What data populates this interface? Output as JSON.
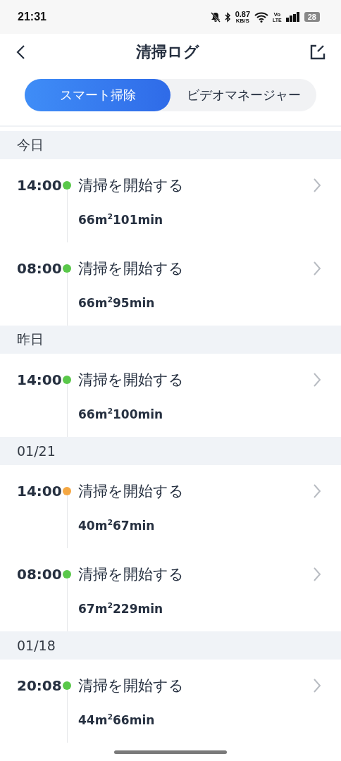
{
  "status_bar": {
    "time": "21:31",
    "net_speed": "0.87",
    "net_unit": "KB/S",
    "volte_top": "Vo",
    "volte_bottom": "LTE",
    "battery": "28"
  },
  "header": {
    "title": "清掃ログ"
  },
  "tabs": [
    {
      "label": "スマート掃除",
      "selected": true
    },
    {
      "label": "ビデオマネージャー",
      "selected": false
    }
  ],
  "sections": [
    {
      "date": "今日",
      "entries": [
        {
          "time": "14:00",
          "color": "#5ac84a",
          "title": "清掃を開始する",
          "summary": "66m$^{2}$101min"
        },
        {
          "time": "08:00",
          "color": "#5ac84a",
          "title": "清掃を開始する",
          "summary": "66m$^{2}$95min"
        }
      ]
    },
    {
      "date": "昨日",
      "entries": [
        {
          "time": "14:00",
          "color": "#5ac84a",
          "title": "清掃を開始する",
          "summary": "66m$^{2}$100min"
        }
      ]
    },
    {
      "date": "01/21",
      "entries": [
        {
          "time": "14:00",
          "color": "#f5a742",
          "title": "清掃を開始する",
          "summary": "40m$^{2}$67min"
        },
        {
          "time": "08:00",
          "color": "#5ac84a",
          "title": "清掃を開始する",
          "summary": "67m$^{2}$229min"
        }
      ]
    },
    {
      "date": "01/18",
      "entries": [
        {
          "time": "20:08",
          "color": "#5ac84a",
          "title": "清掃を開始する",
          "summary": "44m$^{2}$66min"
        }
      ]
    }
  ]
}
